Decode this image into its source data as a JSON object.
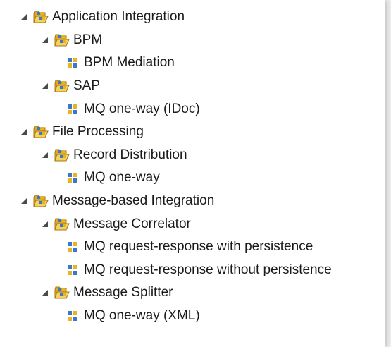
{
  "tree": {
    "nodes": [
      {
        "label": "Application Integration",
        "depth": 0,
        "type": "category",
        "expanded": true
      },
      {
        "label": "BPM",
        "depth": 1,
        "type": "category",
        "expanded": true
      },
      {
        "label": "BPM Mediation",
        "depth": 2,
        "type": "pattern"
      },
      {
        "label": "SAP",
        "depth": 1,
        "type": "category",
        "expanded": true
      },
      {
        "label": "MQ one-way (IDoc)",
        "depth": 2,
        "type": "pattern"
      },
      {
        "label": "File Processing",
        "depth": 0,
        "type": "category",
        "expanded": true
      },
      {
        "label": "Record Distribution",
        "depth": 1,
        "type": "category",
        "expanded": true
      },
      {
        "label": "MQ one-way",
        "depth": 2,
        "type": "pattern"
      },
      {
        "label": "Message-based Integration",
        "depth": 0,
        "type": "category",
        "expanded": true
      },
      {
        "label": "Message Correlator",
        "depth": 1,
        "type": "category",
        "expanded": true
      },
      {
        "label": "MQ request-response with persistence",
        "depth": 2,
        "type": "pattern"
      },
      {
        "label": "MQ request-response without persistence",
        "depth": 2,
        "type": "pattern"
      },
      {
        "label": "Message Splitter",
        "depth": 1,
        "type": "category",
        "expanded": true
      },
      {
        "label": "MQ one-way (XML)",
        "depth": 2,
        "type": "pattern"
      }
    ]
  },
  "icons": {
    "expanded_twisty": "expanded-triangle-icon",
    "category": "open-folder-pattern-icon",
    "pattern": "pattern-grid-icon"
  },
  "colors": {
    "folder_yellow": "#f2c84b",
    "folder_dark": "#b8861b",
    "grid_blue": "#3a78c9",
    "grid_yellow": "#e8b422",
    "twisty": "#4a4a4a"
  }
}
